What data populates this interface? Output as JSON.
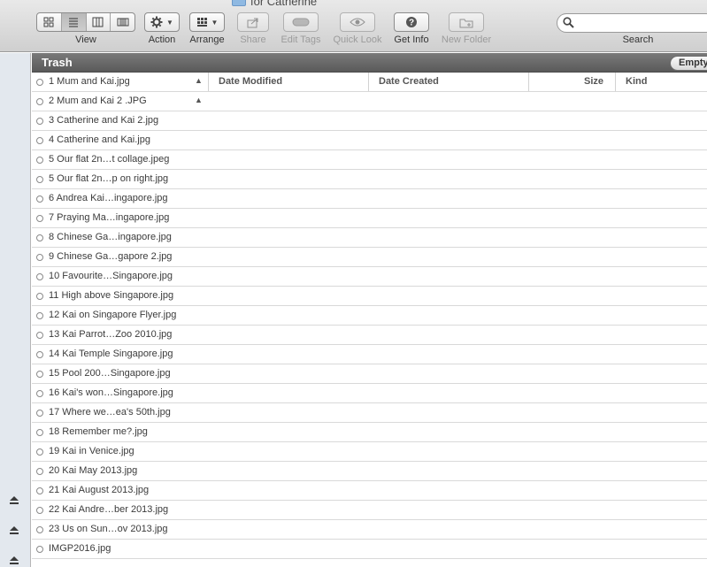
{
  "window": {
    "title": "for Catherine"
  },
  "toolbar": {
    "view_label": "View",
    "action_label": "Action",
    "arrange_label": "Arrange",
    "share_label": "Share",
    "edit_tags_label": "Edit Tags",
    "quick_look_label": "Quick Look",
    "get_info_label": "Get Info",
    "new_folder_label": "New Folder",
    "search_label": "Search",
    "search_placeholder": ""
  },
  "pathbar": {
    "title": "Trash",
    "empty_button": "Empty"
  },
  "columns": {
    "date_modified": "Date Modified",
    "date_created": "Date Created",
    "size": "Size",
    "kind": "Kind"
  },
  "files": [
    "1 Mum and Kai.jpg",
    "2 Mum and Kai 2 .JPG",
    "3 Catherine and Kai 2.jpg",
    "4 Catherine and Kai.jpg",
    "5 Our flat 2n…t collage.jpeg",
    "5 Our flat 2n…p on right.jpg",
    "6 Andrea Kai…ingapore.jpg",
    "7 Praying Ma…ingapore.jpg",
    "8 Chinese Ga…ingapore.jpg",
    "9 Chinese Ga…gapore 2.jpg",
    "10 Favourite…Singapore.jpg",
    "11 High above Singapore.jpg",
    "12 Kai on Singapore Flyer.jpg",
    "13 Kai Parrot…Zoo 2010.jpg",
    "14 Kai Temple Singapore.jpg",
    "15 Pool 200…Singapore.jpg",
    "16 Kai's won…Singapore.jpg",
    "17 Where we…ea's 50th.jpg",
    "18 Remember me?.jpg",
    "19 Kai in Venice.jpg",
    "20 Kai May 2013.jpg",
    "21 Kai August 2013.jpg",
    "22 Kai Andre…ber 2013.jpg",
    "23 Us on Sun…ov 2013.jpg",
    "IMGP2016.jpg"
  ]
}
